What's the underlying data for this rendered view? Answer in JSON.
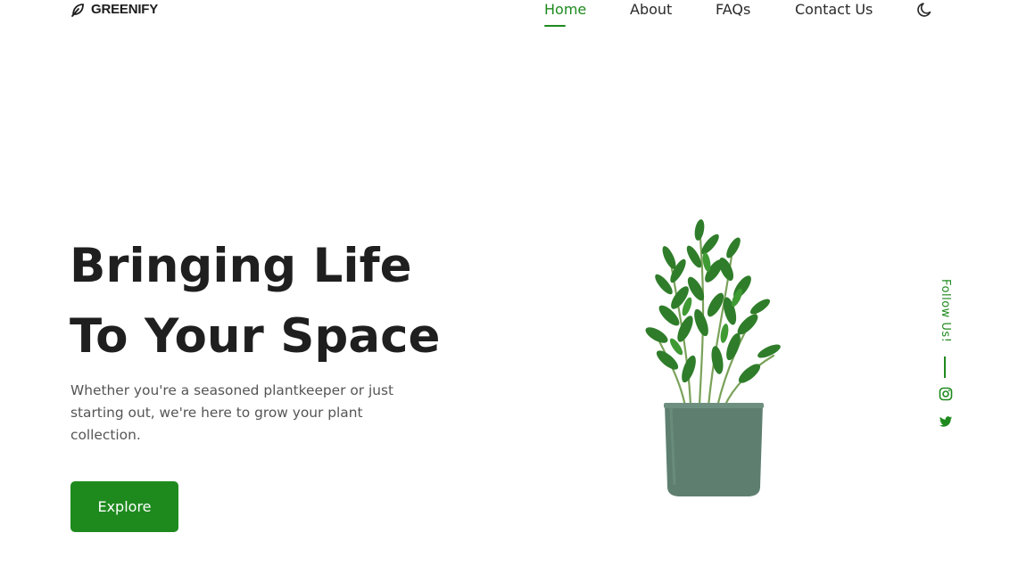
{
  "brand": {
    "name": "GREENIFY",
    "logo_icon": "leaf-icon"
  },
  "nav": {
    "items": [
      {
        "label": "Home",
        "active": true
      },
      {
        "label": "About",
        "active": false
      },
      {
        "label": "FAQs",
        "active": false
      },
      {
        "label": "Contact Us",
        "active": false
      }
    ],
    "theme_icon": "moon-icon"
  },
  "hero": {
    "title_line1": "Bringing Life",
    "title_line2": "To Your Space",
    "description": "Whether you're a seasoned plantkeeper or just starting out, we're here to grow your plant collection.",
    "cta_label": "Explore",
    "image": "potted-plant"
  },
  "social": {
    "label": "Follow Us!",
    "icons": [
      "instagram-icon",
      "twitter-icon"
    ]
  },
  "colors": {
    "accent": "#1e8a1e",
    "text": "#1f1f1f",
    "muted": "#555555",
    "pot": "#5e7f70"
  }
}
